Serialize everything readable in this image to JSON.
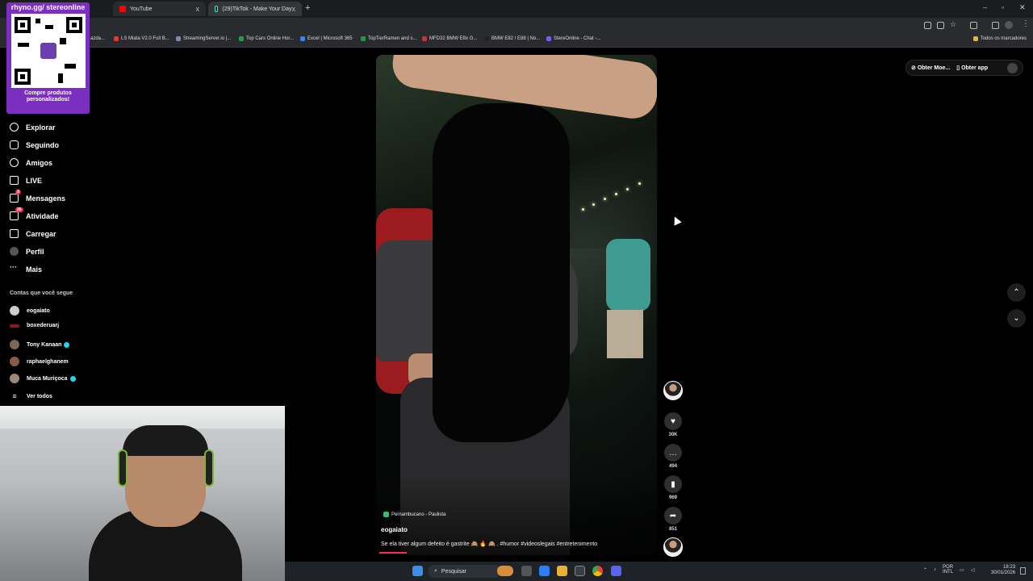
{
  "browser": {
    "tabs": [
      {
        "title": "YouTube",
        "x": "x"
      },
      {
        "title": "(29)TikTok - Make Your Day",
        "x": "x"
      }
    ],
    "new_tab": "+",
    "bookmarks": [
      {
        "label": "azda..."
      },
      {
        "label": "LS Miata V2.0 Full B..."
      },
      {
        "label": "StreamingServer.io |..."
      },
      {
        "label": "Top Cars Online Hor..."
      },
      {
        "label": "Excel | Microsoft 365"
      },
      {
        "label": "TopTierRamen and s..."
      },
      {
        "label": "MFD32 BMW E8x G..."
      },
      {
        "label": "BMW E82 / E88 | No..."
      },
      {
        "label": "StereOnline - Chat -..."
      }
    ],
    "all_bookmarks": "Todos os marcadores"
  },
  "overlay": {
    "url": "rhyno.gg/ stereonline",
    "caption": "Compre produtos personalizados!"
  },
  "sidebar": {
    "items": [
      {
        "label": "Explorar"
      },
      {
        "label": "Seguindo"
      },
      {
        "label": "Amigos"
      },
      {
        "label": "LIVE"
      },
      {
        "label": "Mensagens",
        "badge": "3"
      },
      {
        "label": "Atividade",
        "badge": "26"
      },
      {
        "label": "Carregar"
      },
      {
        "label": "Perfil"
      },
      {
        "label": "Mais"
      }
    ],
    "following_title": "Contas que você segue",
    "accounts": [
      {
        "name": "eogaiato"
      },
      {
        "name": "boxederuarj"
      },
      {
        "name": "Tony Kanaan",
        "verified": true
      },
      {
        "name": "raphaelghanem"
      },
      {
        "name": "Muca Muriçoca",
        "verified": true
      }
    ],
    "see_all": "Ver todos"
  },
  "video": {
    "location": "Pernambucano - Paulista",
    "username": "eogaiato",
    "caption": "Se ela tiver algum defeito é gastrite 🙈 🔥 🙈 . #humor #videoslegais #entretenimento",
    "progress": 0.1
  },
  "actions": {
    "likes": "30K",
    "comments": "494",
    "saves": "969",
    "shares": "851"
  },
  "top_actions": {
    "coins": "Obter Moe...",
    "app": "Obter app"
  },
  "taskbar": {
    "search": "Pesquisar",
    "lang": "POR",
    "lang2": "INTL",
    "time": "18:23",
    "date": "30/01/2026"
  },
  "colors": {
    "accent": "#fe2c55",
    "overlay_purple": "#7b2fbf",
    "verified": "#20d5ec"
  }
}
